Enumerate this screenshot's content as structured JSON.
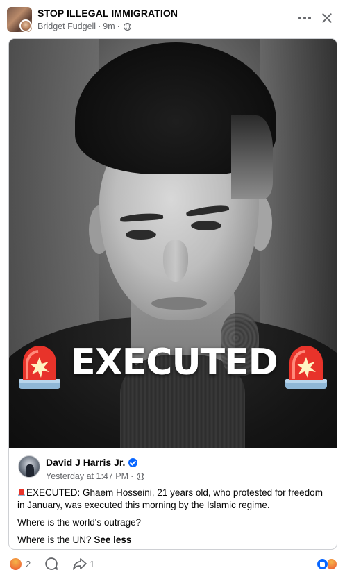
{
  "header": {
    "group_name": "STOP ILLEGAL IMMIGRATION",
    "author": "Bridget Fudgell",
    "time": "9m",
    "separator": "·"
  },
  "photo": {
    "overlay_text": "EXECUTED",
    "siren_icon": "police-siren-icon"
  },
  "shared_post": {
    "author": "David J Harris Jr.",
    "verified": true,
    "timestamp": "Yesterday at 1:47 PM",
    "separator": "·",
    "text_line1": "EXECUTED: Ghaem Hosseini, 21 years old, who protested for freedom in January, was executed this morning by the Islamic regime.",
    "text_line2": "Where is the world's outrage?",
    "text_line3": "Where is the UN?",
    "see_less": "See less"
  },
  "footer": {
    "reaction_count": "2",
    "share_count": "1"
  },
  "colors": {
    "meta_gray": "#65676b",
    "verified_blue": "#0866ff",
    "siren_red": "#e8332a",
    "border": "#ced0d4"
  }
}
